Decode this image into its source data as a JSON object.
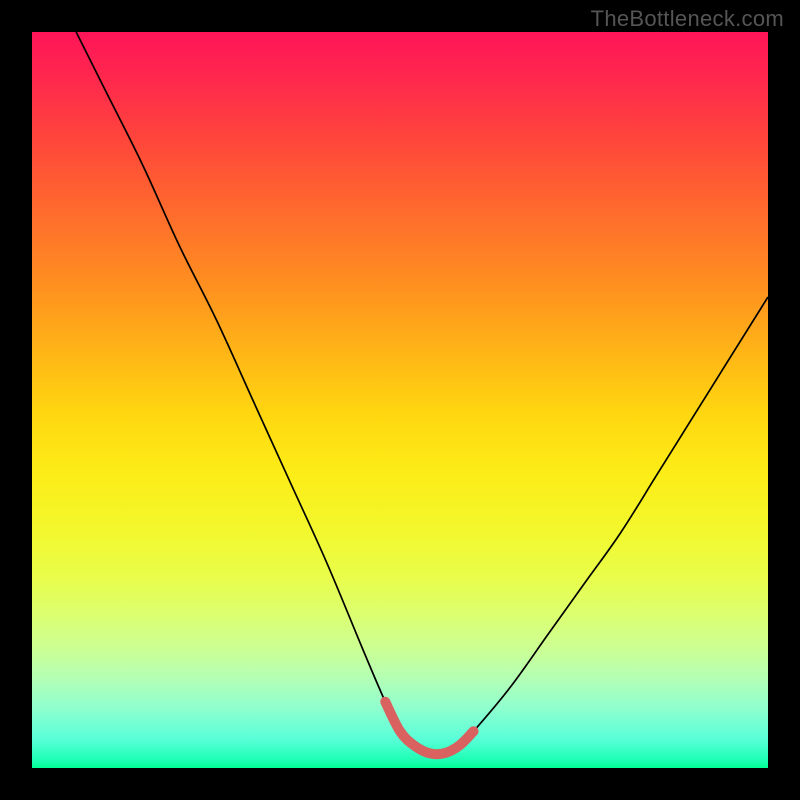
{
  "watermark": "TheBottleneck.com",
  "chart_data": {
    "type": "line",
    "title": "",
    "xlabel": "",
    "ylabel": "",
    "xlim": [
      0,
      100
    ],
    "ylim": [
      0,
      100
    ],
    "grid": false,
    "legend": false,
    "series": [
      {
        "name": "bottleneck-curve",
        "color": "#000000",
        "x": [
          6,
          10,
          15,
          20,
          25,
          30,
          35,
          40,
          45,
          48,
          50,
          52,
          54,
          56,
          58,
          60,
          65,
          70,
          75,
          80,
          85,
          90,
          95,
          100
        ],
        "y": [
          100,
          92,
          82,
          71,
          61,
          50,
          39,
          28,
          16,
          9,
          5,
          3,
          2,
          2,
          3,
          5,
          11,
          18,
          25,
          32,
          40,
          48,
          56,
          64
        ]
      },
      {
        "name": "optimal-zone",
        "color": "#d9615f",
        "x": [
          48,
          50,
          52,
          54,
          56,
          58,
          60
        ],
        "y": [
          9,
          5,
          3,
          2,
          2,
          3,
          5
        ]
      }
    ],
    "annotations": [],
    "background_gradient": {
      "top_color": "#ff1558",
      "bottom_color": "#00ff94",
      "description": "red-to-green vertical gradient"
    }
  }
}
